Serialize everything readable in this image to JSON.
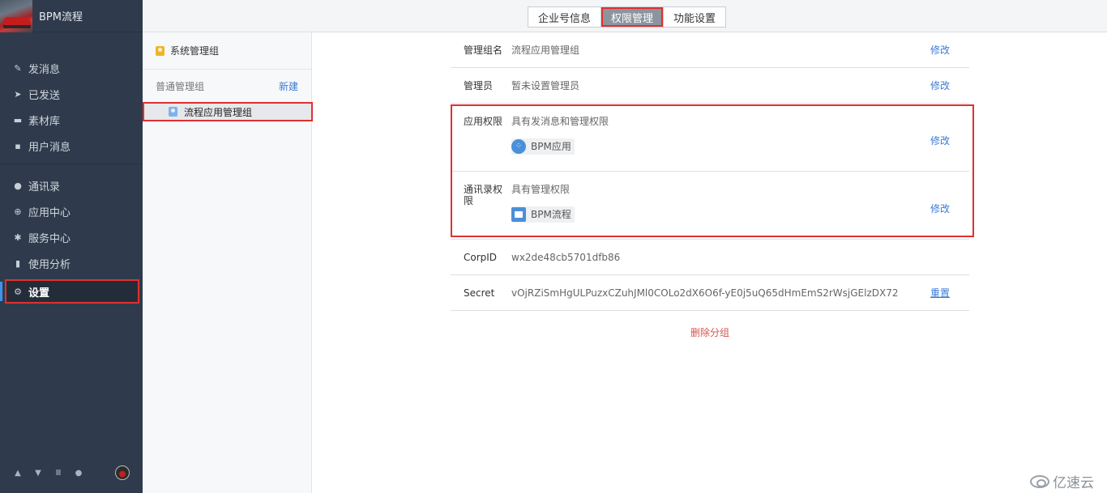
{
  "brand": {
    "name": "BPM流程"
  },
  "sidebar": {
    "group1": [
      {
        "label": "发消息",
        "icon": "pencil-icon"
      },
      {
        "label": "已发送",
        "icon": "send-icon"
      },
      {
        "label": "素材库",
        "icon": "folder-icon"
      },
      {
        "label": "用户消息",
        "icon": "chat-icon"
      }
    ],
    "group2": [
      {
        "label": "通讯录",
        "icon": "contacts-icon"
      },
      {
        "label": "应用中心",
        "icon": "app-center-icon"
      },
      {
        "label": "服务中心",
        "icon": "service-icon"
      },
      {
        "label": "使用分析",
        "icon": "bar-chart-icon"
      },
      {
        "label": "设置",
        "icon": "gear-icon",
        "active": true
      }
    ],
    "footer_icons": [
      "home-icon",
      "cart-icon",
      "book-icon",
      "help-icon"
    ]
  },
  "tabs": [
    {
      "label": "企业号信息",
      "active": false
    },
    {
      "label": "权限管理",
      "active": true
    },
    {
      "label": "功能设置",
      "active": false
    }
  ],
  "groups": {
    "system_group": "系统管理组",
    "normal_title": "普通管理组",
    "new_label": "新建",
    "items": [
      "流程应用管理组"
    ]
  },
  "detail": {
    "group_name": {
      "label": "管理组名",
      "value": "流程应用管理组",
      "action": "修改"
    },
    "admin": {
      "label": "管理员",
      "value": "暂未设置管理员",
      "action": "修改"
    },
    "app_perm": {
      "label": "应用权限",
      "value": "具有发消息和管理权限",
      "chip": "BPM应用",
      "action": "修改"
    },
    "contact_perm": {
      "label": "通讯录权限",
      "value": "具有管理权限",
      "chip": "BPM流程",
      "action": "修改"
    },
    "corpid": {
      "label": "CorpID",
      "value": "wx2de48cb5701dfb86"
    },
    "secret": {
      "label": "Secret",
      "value": "vOjRZiSmHgULPuzxCZuhJMl0COLo2dX6O6f-yE0j5uQ65dHmEmS2rWsjGElzDX72",
      "action": "重置"
    },
    "delete_label": "删除分组"
  },
  "watermark": "亿速云",
  "colors": {
    "sidebar_bg": "#2f3b4c",
    "link": "#3a7bd5",
    "danger": "#d9534f",
    "highlight_border": "#e03030"
  }
}
